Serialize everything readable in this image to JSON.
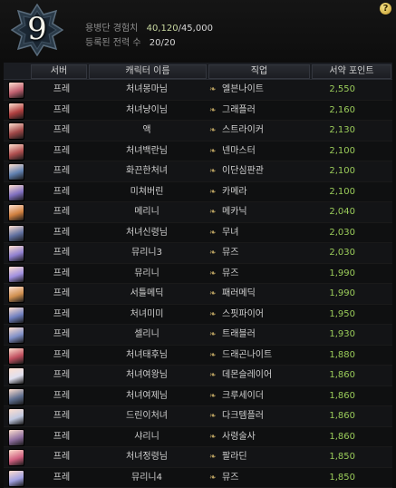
{
  "header": {
    "level": "9",
    "exp_label": "용병단 경험치",
    "exp_current": "40,120",
    "exp_total": "/45,000",
    "roster_label": "등록된 전력 수",
    "roster_value": "20/20",
    "help_label": "?"
  },
  "table": {
    "headers": [
      "서버",
      "캐릭터 이름",
      "직업",
      "서약 포인트"
    ],
    "rows": [
      {
        "server": "프레",
        "name": "처녀몽마님",
        "job": "엘븐나이트",
        "score": "2,550",
        "color": "#c06070"
      },
      {
        "server": "프레",
        "name": "처녀냥이님",
        "job": "그래플러",
        "score": "2,160",
        "color": "#b04040"
      },
      {
        "server": "프레",
        "name": "액",
        "job": "스트라이커",
        "score": "2,130",
        "color": "#a04848"
      },
      {
        "server": "프레",
        "name": "처녀백란님",
        "job": "넨마스터",
        "score": "2,100",
        "color": "#b05050"
      },
      {
        "server": "프레",
        "name": "화끈한처녀",
        "job": "이단심판관",
        "score": "2,100",
        "color": "#6080b0"
      },
      {
        "server": "프레",
        "name": "미쳐버린",
        "job": "카메라",
        "score": "2,100",
        "color": "#8070c0"
      },
      {
        "server": "프레",
        "name": "메리니",
        "job": "메카닉",
        "score": "2,040",
        "color": "#d08040"
      },
      {
        "server": "프레",
        "name": "처녀신령님",
        "job": "무녀",
        "score": "2,030",
        "color": "#6070a0"
      },
      {
        "server": "프레",
        "name": "뮤리니3",
        "job": "뮤즈",
        "score": "2,030",
        "color": "#9080d0"
      },
      {
        "server": "프레",
        "name": "뮤리니",
        "job": "뮤즈",
        "score": "1,990",
        "color": "#a090e0"
      },
      {
        "server": "프레",
        "name": "서틀메딕",
        "job": "패러메딕",
        "score": "1,990",
        "color": "#d09050"
      },
      {
        "server": "프레",
        "name": "처녀미미",
        "job": "스핏파이어",
        "score": "1,950",
        "color": "#7080c0"
      },
      {
        "server": "프레",
        "name": "셀리니",
        "job": "트래블러",
        "score": "1,930",
        "color": "#8090c8"
      },
      {
        "server": "프레",
        "name": "처녀태후님",
        "job": "드래곤나이트",
        "score": "1,880",
        "color": "#c05060"
      },
      {
        "server": "프레",
        "name": "처녀여왕님",
        "job": "데몬슬레이어",
        "score": "1,860",
        "color": "#e0e0f0"
      },
      {
        "server": "프레",
        "name": "처녀여제님",
        "job": "크루세이더",
        "score": "1,860",
        "color": "#607090"
      },
      {
        "server": "프레",
        "name": "드린이처녀",
        "job": "다크템플러",
        "score": "1,860",
        "color": "#c0c8e0"
      },
      {
        "server": "프레",
        "name": "샤리니",
        "job": "사령술사",
        "score": "1,860",
        "color": "#9070a0"
      },
      {
        "server": "프레",
        "name": "처녀정령님",
        "job": "팔라딘",
        "score": "1,850",
        "color": "#d06080"
      },
      {
        "server": "프레",
        "name": "뮤리니4",
        "job": "뮤즈",
        "score": "1,850",
        "color": "#a0a0e0"
      }
    ]
  }
}
